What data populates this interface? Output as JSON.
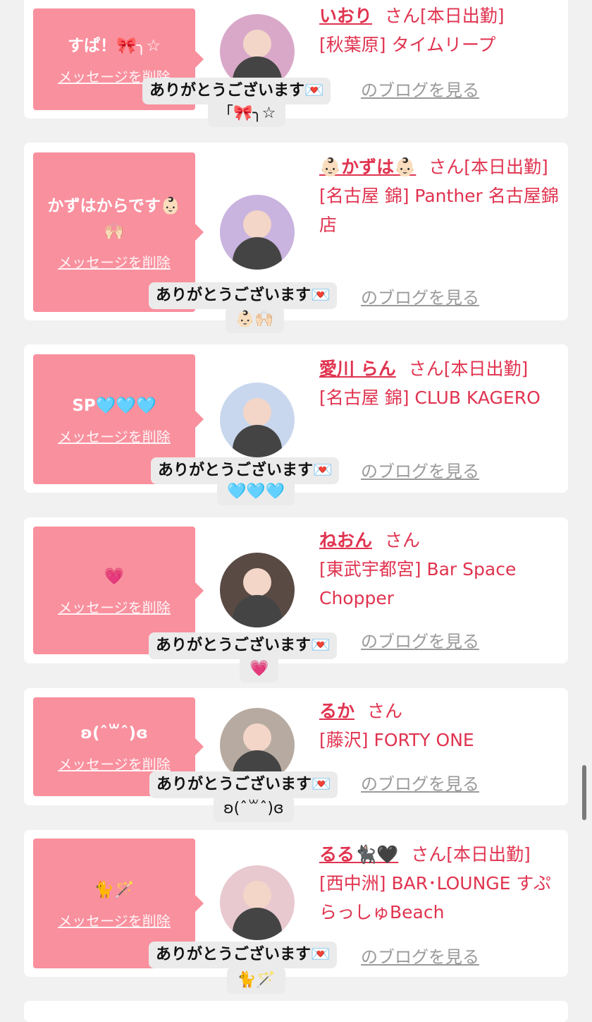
{
  "messages": [
    {
      "message": "すぱ！🎀╮☆",
      "delete_label": "メッセージを削除",
      "name": "いおり",
      "honorific": "さん",
      "status": "[本日出勤]",
      "shop": "[秋葉原] タイムリープ",
      "blog_label": "のブログを見る",
      "thanks": "ありがとうございます💌",
      "reaction": "「🎀╮☆",
      "avatar_color": "#d9a8c9"
    },
    {
      "message": "かずはからです👶🏻🙌🏻",
      "delete_label": "メッセージを削除",
      "name": "👶🏻かずは👶🏻",
      "honorific": "さん",
      "status": "[本日出勤]",
      "shop": "[名古屋 錦] Panther 名古屋錦店",
      "blog_label": "のブログを見る",
      "thanks": "ありがとうございます💌",
      "reaction": "👶🏻🙌🏻",
      "avatar_color": "#c9b3df"
    },
    {
      "message": "SP🩵🩵🩵",
      "delete_label": "メッセージを削除",
      "name": "愛川 らん",
      "honorific": "さん",
      "status": "[本日出勤]",
      "shop": "[名古屋 錦] CLUB KAGERO",
      "blog_label": "のブログを見る",
      "thanks": "ありがとうございます💌",
      "reaction": "🩵🩵🩵",
      "avatar_color": "#c8d7ee"
    },
    {
      "message": "💗",
      "delete_label": "メッセージを削除",
      "name": "ねおん",
      "honorific": "さん",
      "status": "",
      "shop": "[東武宇都宮] Bar Space Chopper",
      "blog_label": "のブログを見る",
      "thanks": "ありがとうございます💌",
      "reaction": "💗",
      "avatar_color": "#5a4a44"
    },
    {
      "message": "ʚ(ˆ꒳ˆ)ɞ",
      "delete_label": "メッセージを削除",
      "name": "るか",
      "honorific": "さん",
      "status": "",
      "shop": "[藤沢] FORTY ONE",
      "blog_label": "のブログを見る",
      "thanks": "ありがとうございます💌",
      "reaction": "ʚ(ˆ꒳ˆ)ɞ",
      "avatar_color": "#b7aaa0"
    },
    {
      "message": "🐈🪄",
      "delete_label": "メッセージを削除",
      "name": "るる🐈‍⬛🖤",
      "honorific": "さん",
      "status": "[本日出勤]",
      "shop": "[西中洲] BAR･LOUNGE すぷらっしゅBeach",
      "blog_label": "のブログを見る",
      "thanks": "ありがとうございます💌",
      "reaction": "🐈🪄",
      "avatar_color": "#e8c9cf"
    }
  ]
}
